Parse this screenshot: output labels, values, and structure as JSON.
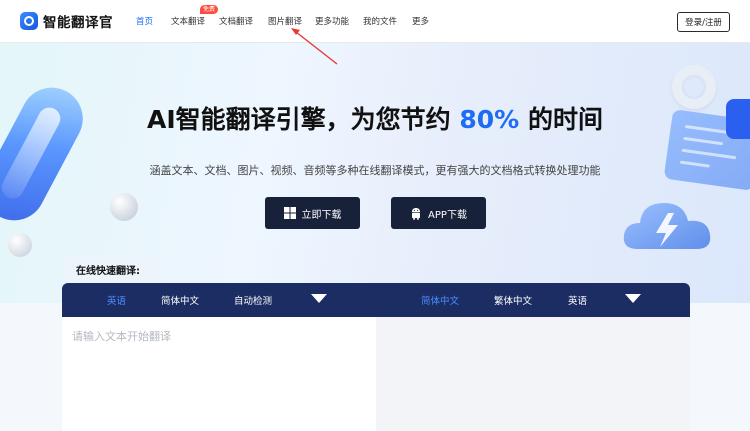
{
  "header": {
    "logo_text": "智能翻译官",
    "nav": [
      {
        "label": "首页",
        "active": true
      },
      {
        "label": "文本翻译",
        "active": false
      },
      {
        "label": "文档翻译",
        "active": false
      },
      {
        "label": "图片翻译",
        "active": false
      },
      {
        "label": "更多功能",
        "active": false
      },
      {
        "label": "我的文件",
        "active": false
      },
      {
        "label": "更多",
        "active": false
      }
    ],
    "free_badge": "免费",
    "login_label": "登录/注册"
  },
  "hero": {
    "title_pre": "AI智能翻译引擎，为您节约",
    "title_highlight": "80%",
    "title_post": "的时间",
    "subtitle": "涵盖文本、文档、图片、视频、音频等多种在线翻译模式，更有强大的文档格式转换处理功能",
    "btn_windows": "立即下载",
    "btn_app": "APP下载"
  },
  "translator": {
    "quick_label": "在线快速翻译:",
    "source_langs": [
      "英语",
      "简体中文",
      "自动检测"
    ],
    "target_langs": [
      "简体中文",
      "繁体中文",
      "英语"
    ],
    "source_placeholder": "请输入文本开始翻译"
  },
  "colors": {
    "accent": "#1e6bf5",
    "bar": "#1b2d63",
    "button_dark": "#18213a",
    "badge": "#ff4d3d"
  }
}
